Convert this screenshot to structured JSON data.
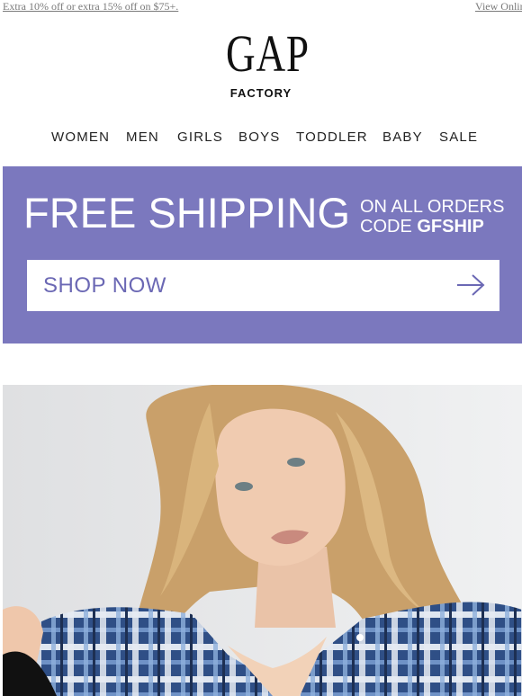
{
  "top_bar": {
    "promo_link": "Extra 10% off or extra 15% off on $75+.",
    "view_online": "View Online"
  },
  "logo": {
    "brand": "GAP",
    "sub": "FACTORY"
  },
  "nav": {
    "items": [
      "WOMEN",
      "MEN",
      "GIRLS",
      "BOYS",
      "TODDLER",
      "BABY",
      "SALE"
    ]
  },
  "banner": {
    "headline": "FREE SHIPPING",
    "line1": "ON ALL ORDERS",
    "code_prefix": "CODE ",
    "code": "GFSHIP",
    "cta": "SHOP NOW",
    "colors": {
      "background": "#7b78be",
      "cta_text": "#6b68b4"
    }
  },
  "hero": {
    "icon": "model-photo"
  }
}
